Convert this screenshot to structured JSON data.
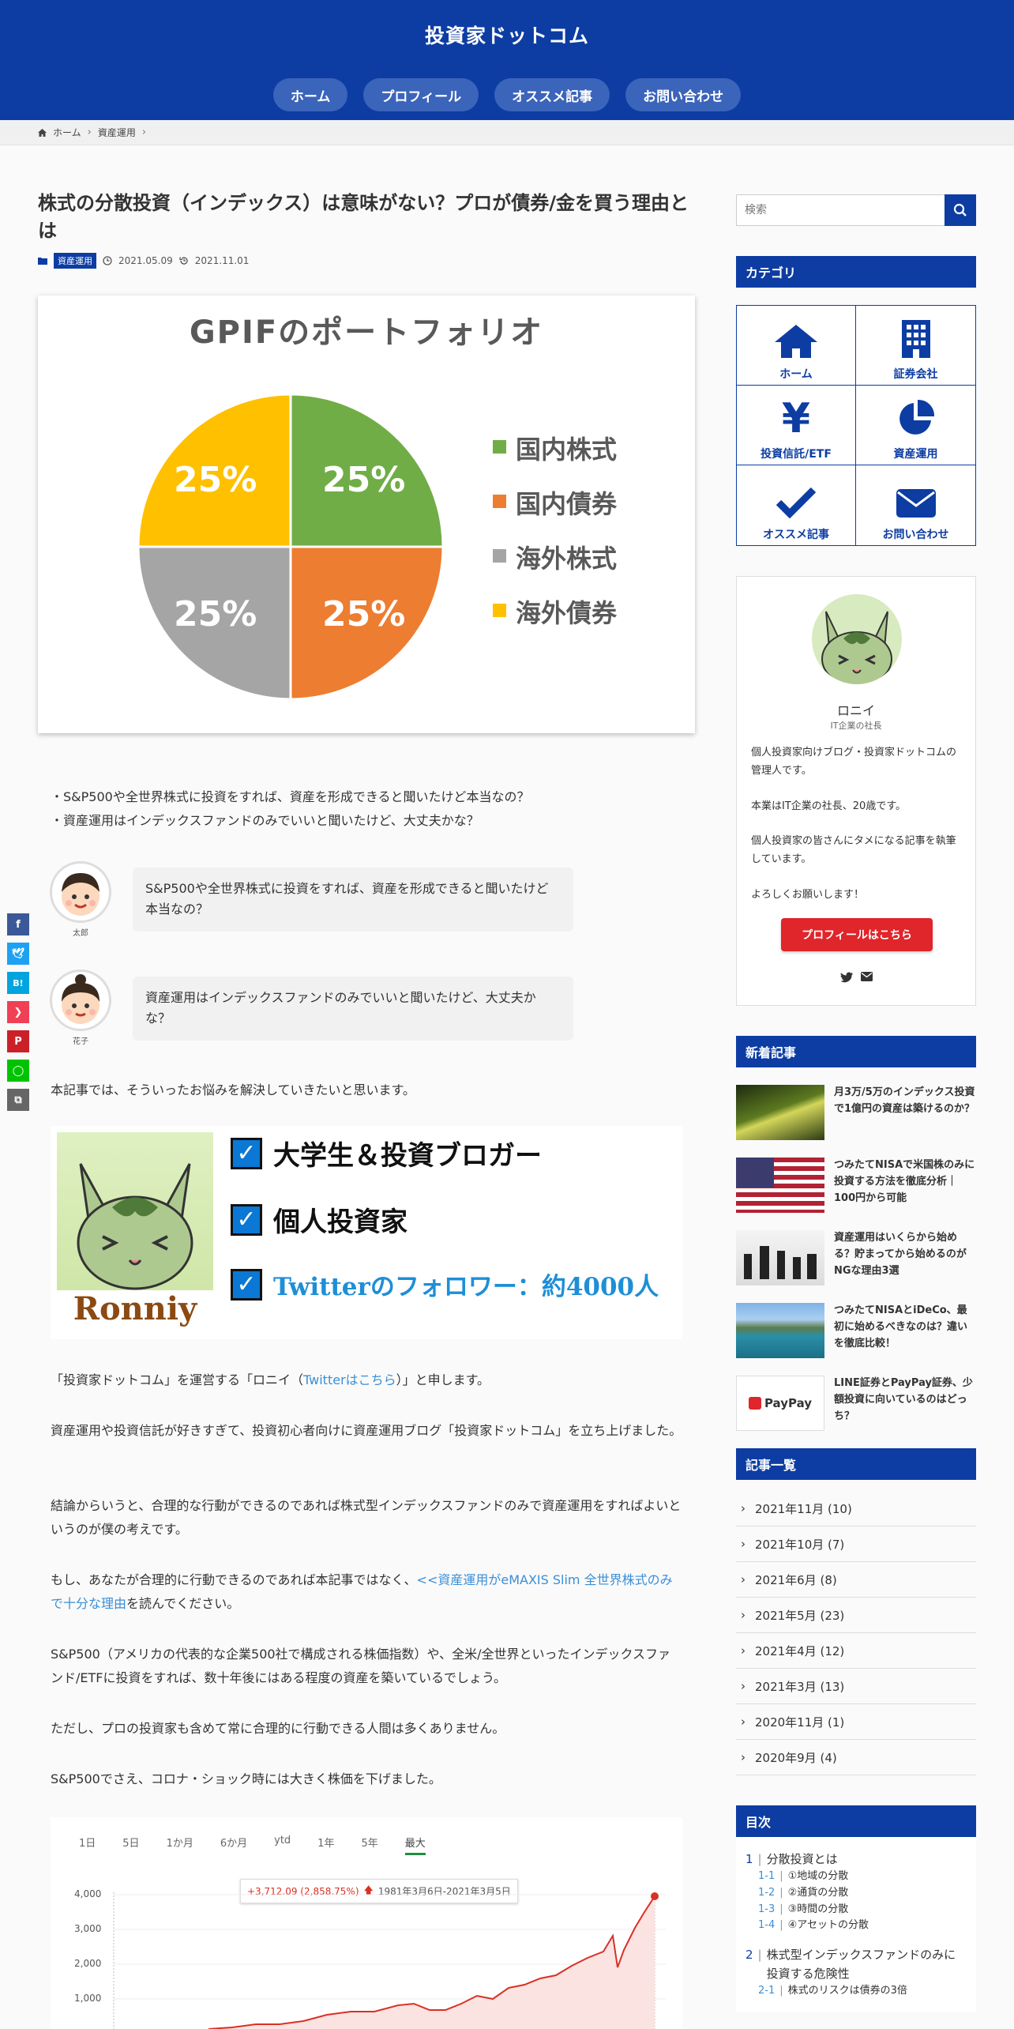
{
  "site_title": "投資家ドットコム",
  "nav": [
    "ホーム",
    "プロフィール",
    "オススメ記事",
    "お問い合わせ"
  ],
  "breadcrumb": {
    "home": "ホーム",
    "category": "資産運用"
  },
  "article": {
    "title": "株式の分散投資（インデックス）は意味がない？プロが債券/金を買う理由とは",
    "category": "資産運用",
    "published": "2021.05.09",
    "updated": "2021.11.01",
    "gpif_chart": {
      "title": "GPIFのポートフォリオ",
      "legend": [
        "国内株式",
        "国内債券",
        "海外株式",
        "海外債券"
      ],
      "colors": [
        "#70ad47",
        "#ed7d31",
        "#a5a5a5",
        "#ffc000"
      ],
      "labels": [
        "25%",
        "25%",
        "25%",
        "25%"
      ]
    },
    "questions": [
      "・S&P500や全世界株式に投資をすれば、資産を形成できると聞いたけど本当なの？",
      "・資産運用はインデックスファンドのみでいいと聞いたけど、大丈夫かな？"
    ],
    "dialog": [
      {
        "name": "太郎",
        "text": "S&P500や全世界株式に投資をすれば、資産を形成できると聞いたけど本当なの？"
      },
      {
        "name": "花子",
        "text": "資産運用はインデックスファンドのみでいいと聞いたけど、大丈夫かな？"
      }
    ],
    "intro": "本記事では、そういったお悩みを解決していきたいと思います。",
    "profile_banner": {
      "name": "Ronniy",
      "items": [
        "大学生＆投資ブロガー",
        "個人投資家",
        "Twitterのフォロワー：約4000人"
      ]
    },
    "p1_a": "「投資家ドットコム」を運営する「ロニイ（",
    "p1_link": "Twitterはこちら",
    "p1_b": "）」と申します。",
    "p2": "資産運用や投資信託が好きすぎて、投資初心者向けに資産運用ブログ「投資家ドットコム」を立ち上げました。",
    "p3": "結論からいうと、合理的な行動ができるのであれば株式型インデックスファンドのみで資産運用をすればよいというのが僕の考えです。",
    "p4_a": "もし、あなたが合理的に行動できるのであれば本記事ではなく、",
    "p4_link": "<<資産運用がeMAXIS Slim 全世界株式のみで十分な理由",
    "p4_b": "を読んでください。",
    "p5": "S&P500（アメリカの代表的な企業500社で構成される株価指数）や、全米/全世界といったインデックスファンド/ETFに投資をすれば、数十年後にはある程度の資産を築いているでしょう。",
    "p6": "ただし、プロの投資家も含めて常に合理的に行動できる人間は多くありません。",
    "p7": "S&P500でさえ、コロナ・ショック時には大きく株価を下げました。",
    "sp_chart": {
      "tabs": [
        "1日",
        "5日",
        "1か月",
        "6か月",
        "ytd",
        "1年",
        "5年",
        "最大"
      ],
      "active_tab": "最大",
      "tooltip_value": "+3,712.09 (2,858.75%)",
      "tooltip_range": "1981年3月6日-2021年3月5日",
      "yticks": [
        "4,000",
        "3,000",
        "2,000",
        "1,000"
      ]
    }
  },
  "share_buttons": [
    "f",
    "t",
    "B!",
    "p",
    "P",
    "L",
    "c"
  ],
  "sidebar": {
    "search_placeholder": "検索",
    "categories_title": "カテゴリ",
    "categories": [
      {
        "label": "ホーム",
        "icon": "home-icon"
      },
      {
        "label": "証券会社",
        "icon": "building-icon"
      },
      {
        "label": "投資信託/ETF",
        "icon": "yen-icon"
      },
      {
        "label": "資産運用",
        "icon": "pie-chart-icon"
      },
      {
        "label": "オススメ記事",
        "icon": "check-icon"
      },
      {
        "label": "お問い合わせ",
        "icon": "envelope-icon"
      }
    ],
    "profile": {
      "name": "ロニイ",
      "role": "IT企業の社長",
      "bio": [
        "個人投資家向けブログ・投資家ドットコムの管理人です。",
        "本業はIT企業の社長、20歳です。",
        "個人投資家の皆さんにタメになる記事を執筆しています。",
        "よろしくお願いします！"
      ],
      "button": "プロフィールはこちら"
    },
    "new_posts_title": "新着記事",
    "new_posts": [
      "月3万/5万のインデックス投資で1億円の資産は築けるのか？",
      "つみたてNISAで米国株のみに投資する方法を徹底分析｜100円から可能",
      "資産運用はいくらから始める？貯まってから始めるのがNGな理由3選",
      "つみたてNISAとiDeCo、最初に始めるべきなのは？違いを徹底比較！",
      "LINE証券とPayPay証券、少額投資に向いているのはどっち？"
    ],
    "paypay_label": "PayPay",
    "archive_title": "記事一覧",
    "archives": [
      "2021年11月 (10)",
      "2021年10月 (7)",
      "2021年6月 (8)",
      "2021年5月 (23)",
      "2021年4月 (12)",
      "2021年3月 (13)",
      "2020年11月 (1)",
      "2020年9月 (4)"
    ],
    "toc_title": "目次",
    "toc": [
      {
        "num": "1",
        "label": "分散投資とは",
        "subs": [
          [
            "1-1",
            "①地域の分散"
          ],
          [
            "1-2",
            "②通貨の分散"
          ],
          [
            "1-3",
            "③時間の分散"
          ],
          [
            "1-4",
            "④アセットの分散"
          ]
        ]
      },
      {
        "num": "2",
        "label": "株式型インデックスファンドのみに投資する危険性",
        "subs": [
          [
            "2-1",
            "株式のリスクは債券の3倍"
          ]
        ]
      }
    ]
  }
}
